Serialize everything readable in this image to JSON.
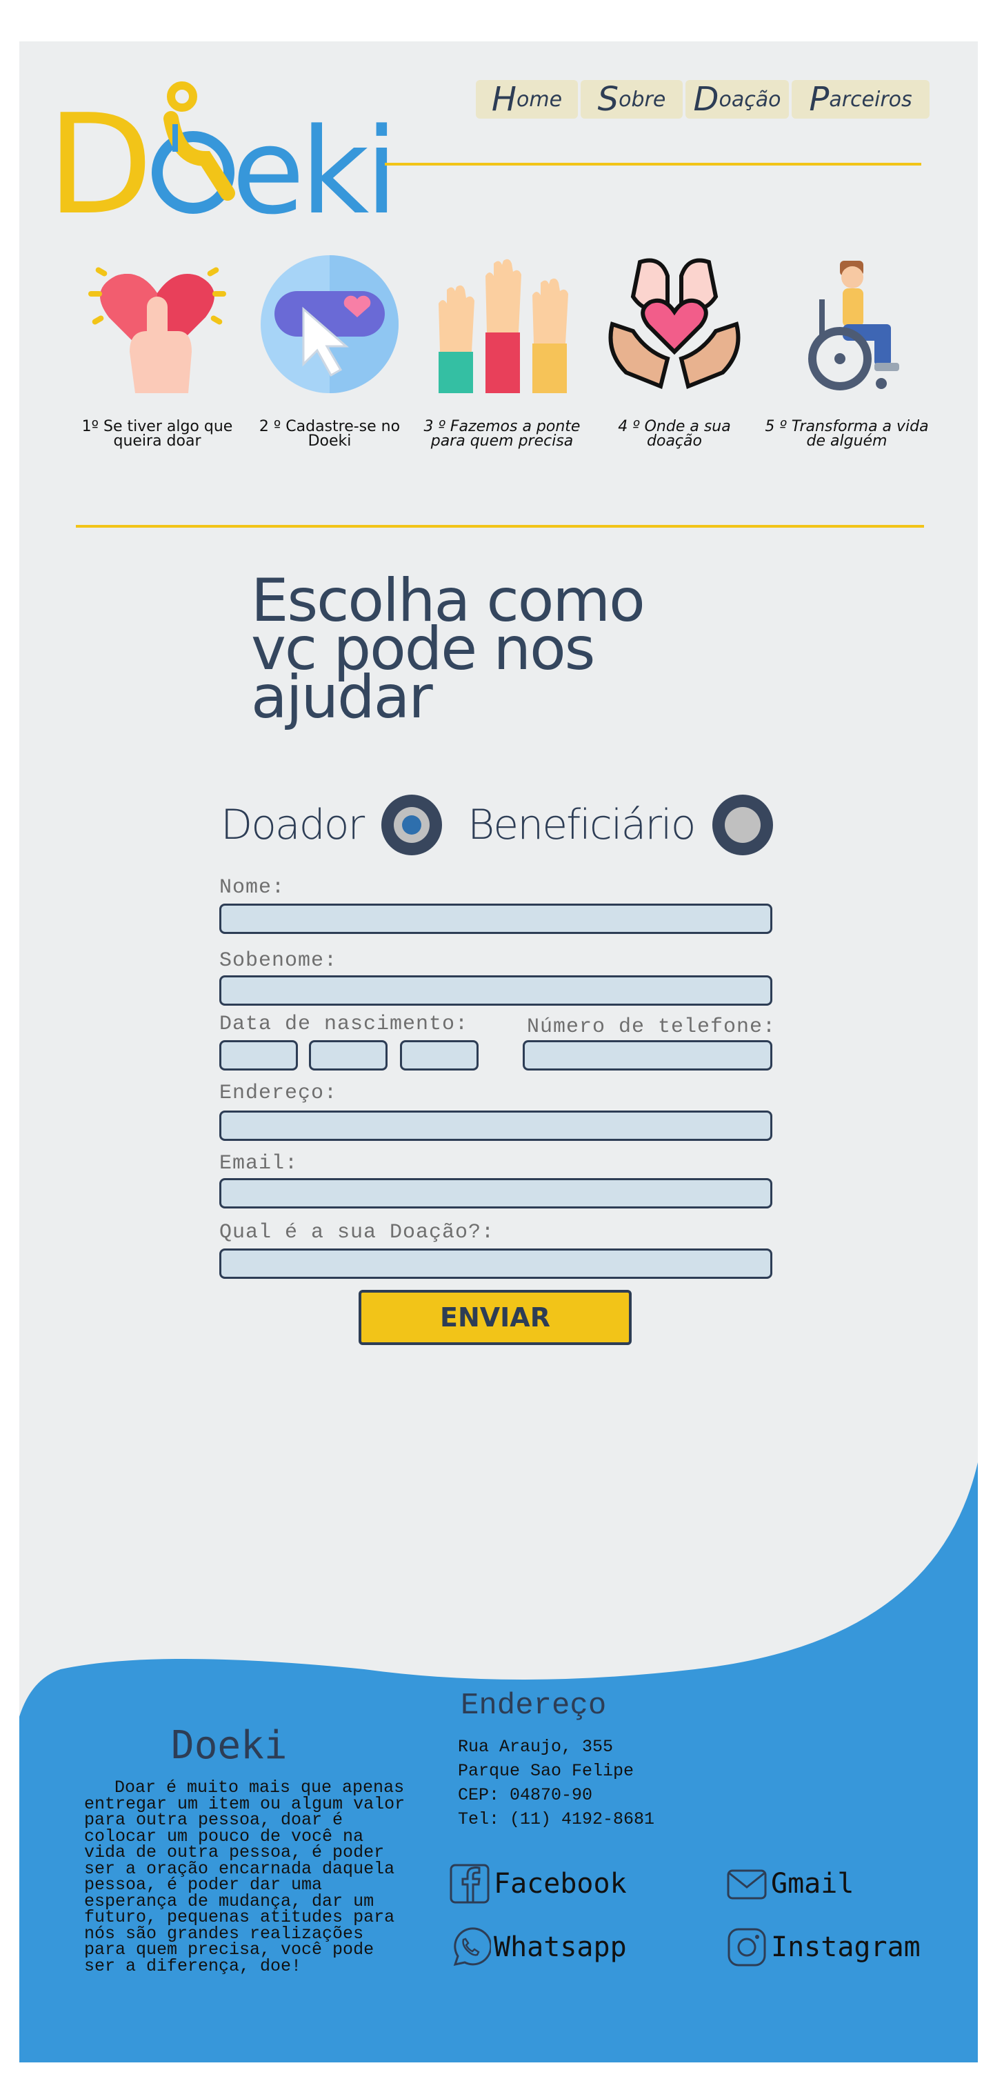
{
  "brand": {
    "logo_text": "Doeki"
  },
  "nav": {
    "items": [
      {
        "first": "H",
        "rest": "ome"
      },
      {
        "first": "S",
        "rest": "obre"
      },
      {
        "first": "D",
        "rest": "oação"
      },
      {
        "first": "P",
        "rest": "arceiros"
      }
    ]
  },
  "steps": [
    {
      "icon": "heart-hand-icon",
      "label": "1º Se tiver algo que queira doar"
    },
    {
      "icon": "click-heart-icon",
      "label": "2 º Cadastre-se no   Doeki"
    },
    {
      "icon": "raised-hands-icon",
      "label": "3 º Fazemos a ponte para quem precisa"
    },
    {
      "icon": "hands-heart-icon",
      "label": "4 º Onde a sua doação"
    },
    {
      "icon": "wheelchair-icon",
      "label": "5 º Transforma a vida de alguém"
    }
  ],
  "form": {
    "headline": "Escolha como vc pode nos ajudar",
    "role_donor": "Doador",
    "role_beneficiary": "Beneficiário",
    "label_name": "Nome:",
    "label_surname": "Sobenome:",
    "label_birth": "Data de nascimento:",
    "label_phone": "Número de telefone:",
    "label_address": "Endereço:",
    "label_email": "Email:",
    "label_donation": "Qual é a sua Doação?:",
    "submit": "ENVIAR"
  },
  "footer": {
    "brand": "Doeki",
    "about": "Doar é muito mais que apenas entregar um item ou algum valor para outra pessoa, doar é colocar um pouco de você na vida de outra pessoa, é poder ser a oração encarnada daquela pessoa, é poder dar uma esperança de mudança, dar um futuro, pequenas atitudes para nós são grandes realizações para quem precisa, você pode ser a diferença, doe!",
    "address_title": "Endereço",
    "address_lines": [
      "Rua Araujo, 355",
      "Parque Sao Felipe",
      "CEP: 04870-90",
      "Tel: (11) 4192-8681"
    ],
    "social": {
      "facebook": "Facebook",
      "gmail": "Gmail",
      "whatsapp": "Whatsapp",
      "instagram": "Instagram"
    }
  },
  "colors": {
    "accent_yellow": "#f2c418",
    "brand_blue": "#3797da",
    "dark_navy": "#2d3d55",
    "field_bg": "#d1e0ea",
    "page_bg": "#eceeef"
  }
}
